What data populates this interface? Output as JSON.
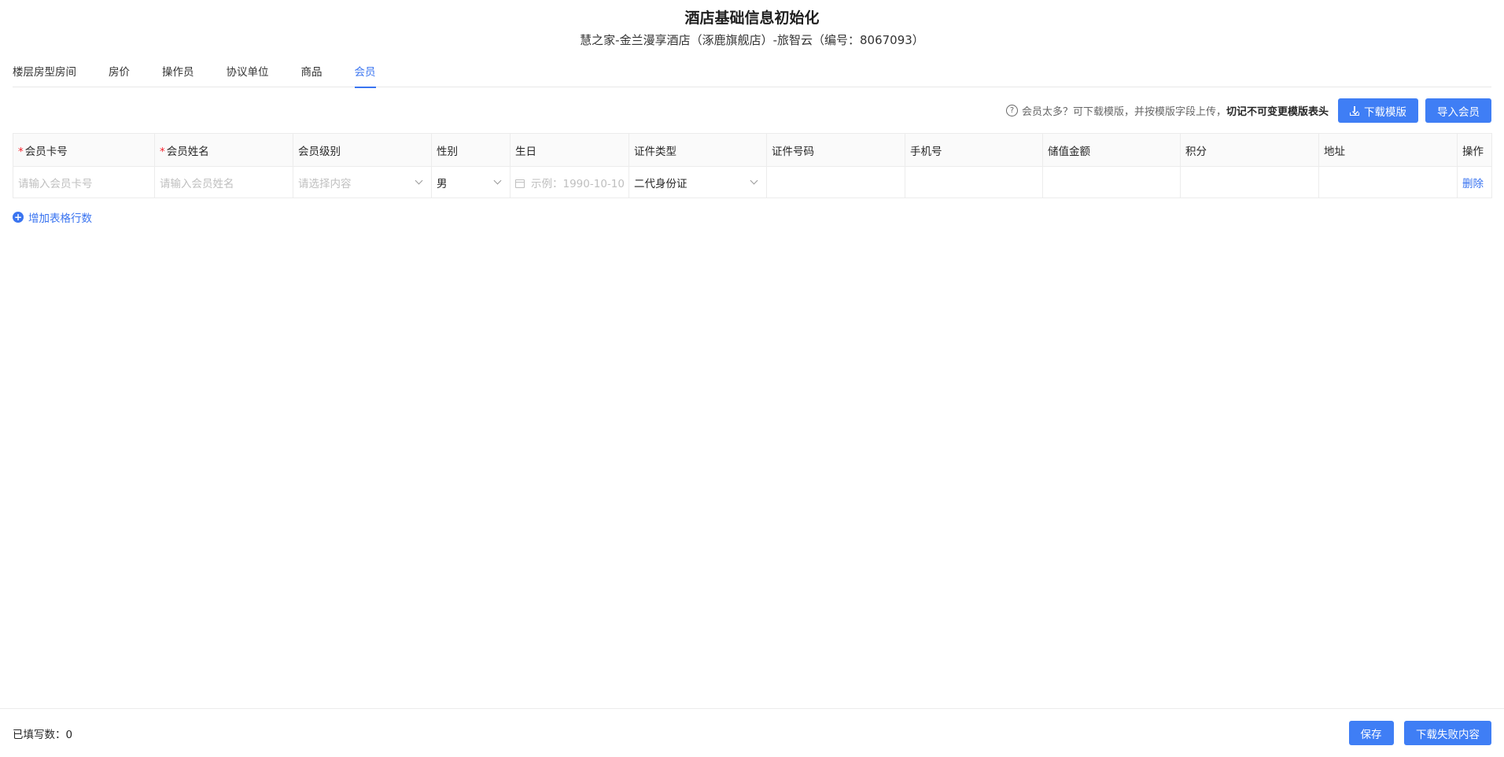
{
  "header": {
    "title": "酒店基础信息初始化",
    "subtitle": "慧之家-金兰漫享酒店（涿鹿旗舰店）-旅智云（编号：8067093）"
  },
  "tabs": [
    {
      "label": "楼层房型房间",
      "active": false
    },
    {
      "label": "房价",
      "active": false
    },
    {
      "label": "操作员",
      "active": false
    },
    {
      "label": "协议单位",
      "active": false
    },
    {
      "label": "商品",
      "active": false
    },
    {
      "label": "会员",
      "active": true
    }
  ],
  "toolbar": {
    "hint": "会员太多？可下载模版，并按模版字段上传，",
    "hint_strong": "切记不可变更模版表头",
    "download_label": "下载模版",
    "import_label": "导入会员",
    "accent": "#3f7ef5"
  },
  "table": {
    "columns": [
      "会员卡号",
      "会员姓名",
      "会员级别",
      "性别",
      "生日",
      "证件类型",
      "证件号码",
      "手机号",
      "储值金额",
      "积分",
      "地址",
      "操作"
    ],
    "required_mark": "*",
    "row": {
      "card_placeholder": "请输入会员卡号",
      "name_placeholder": "请输入会员姓名",
      "level_placeholder": "请选择内容",
      "gender": "男",
      "birthday_placeholder": "示例：1990-10-10",
      "id_type": "二代身份证",
      "id_number": "",
      "phone": "",
      "balance": "",
      "points": "",
      "address": "",
      "delete_label": "删除"
    }
  },
  "add_row_label": "增加表格行数",
  "footer": {
    "count_label": "已填写数：",
    "count_value": "0",
    "save_label": "保存",
    "download_failed_label": "下载失败内容"
  }
}
